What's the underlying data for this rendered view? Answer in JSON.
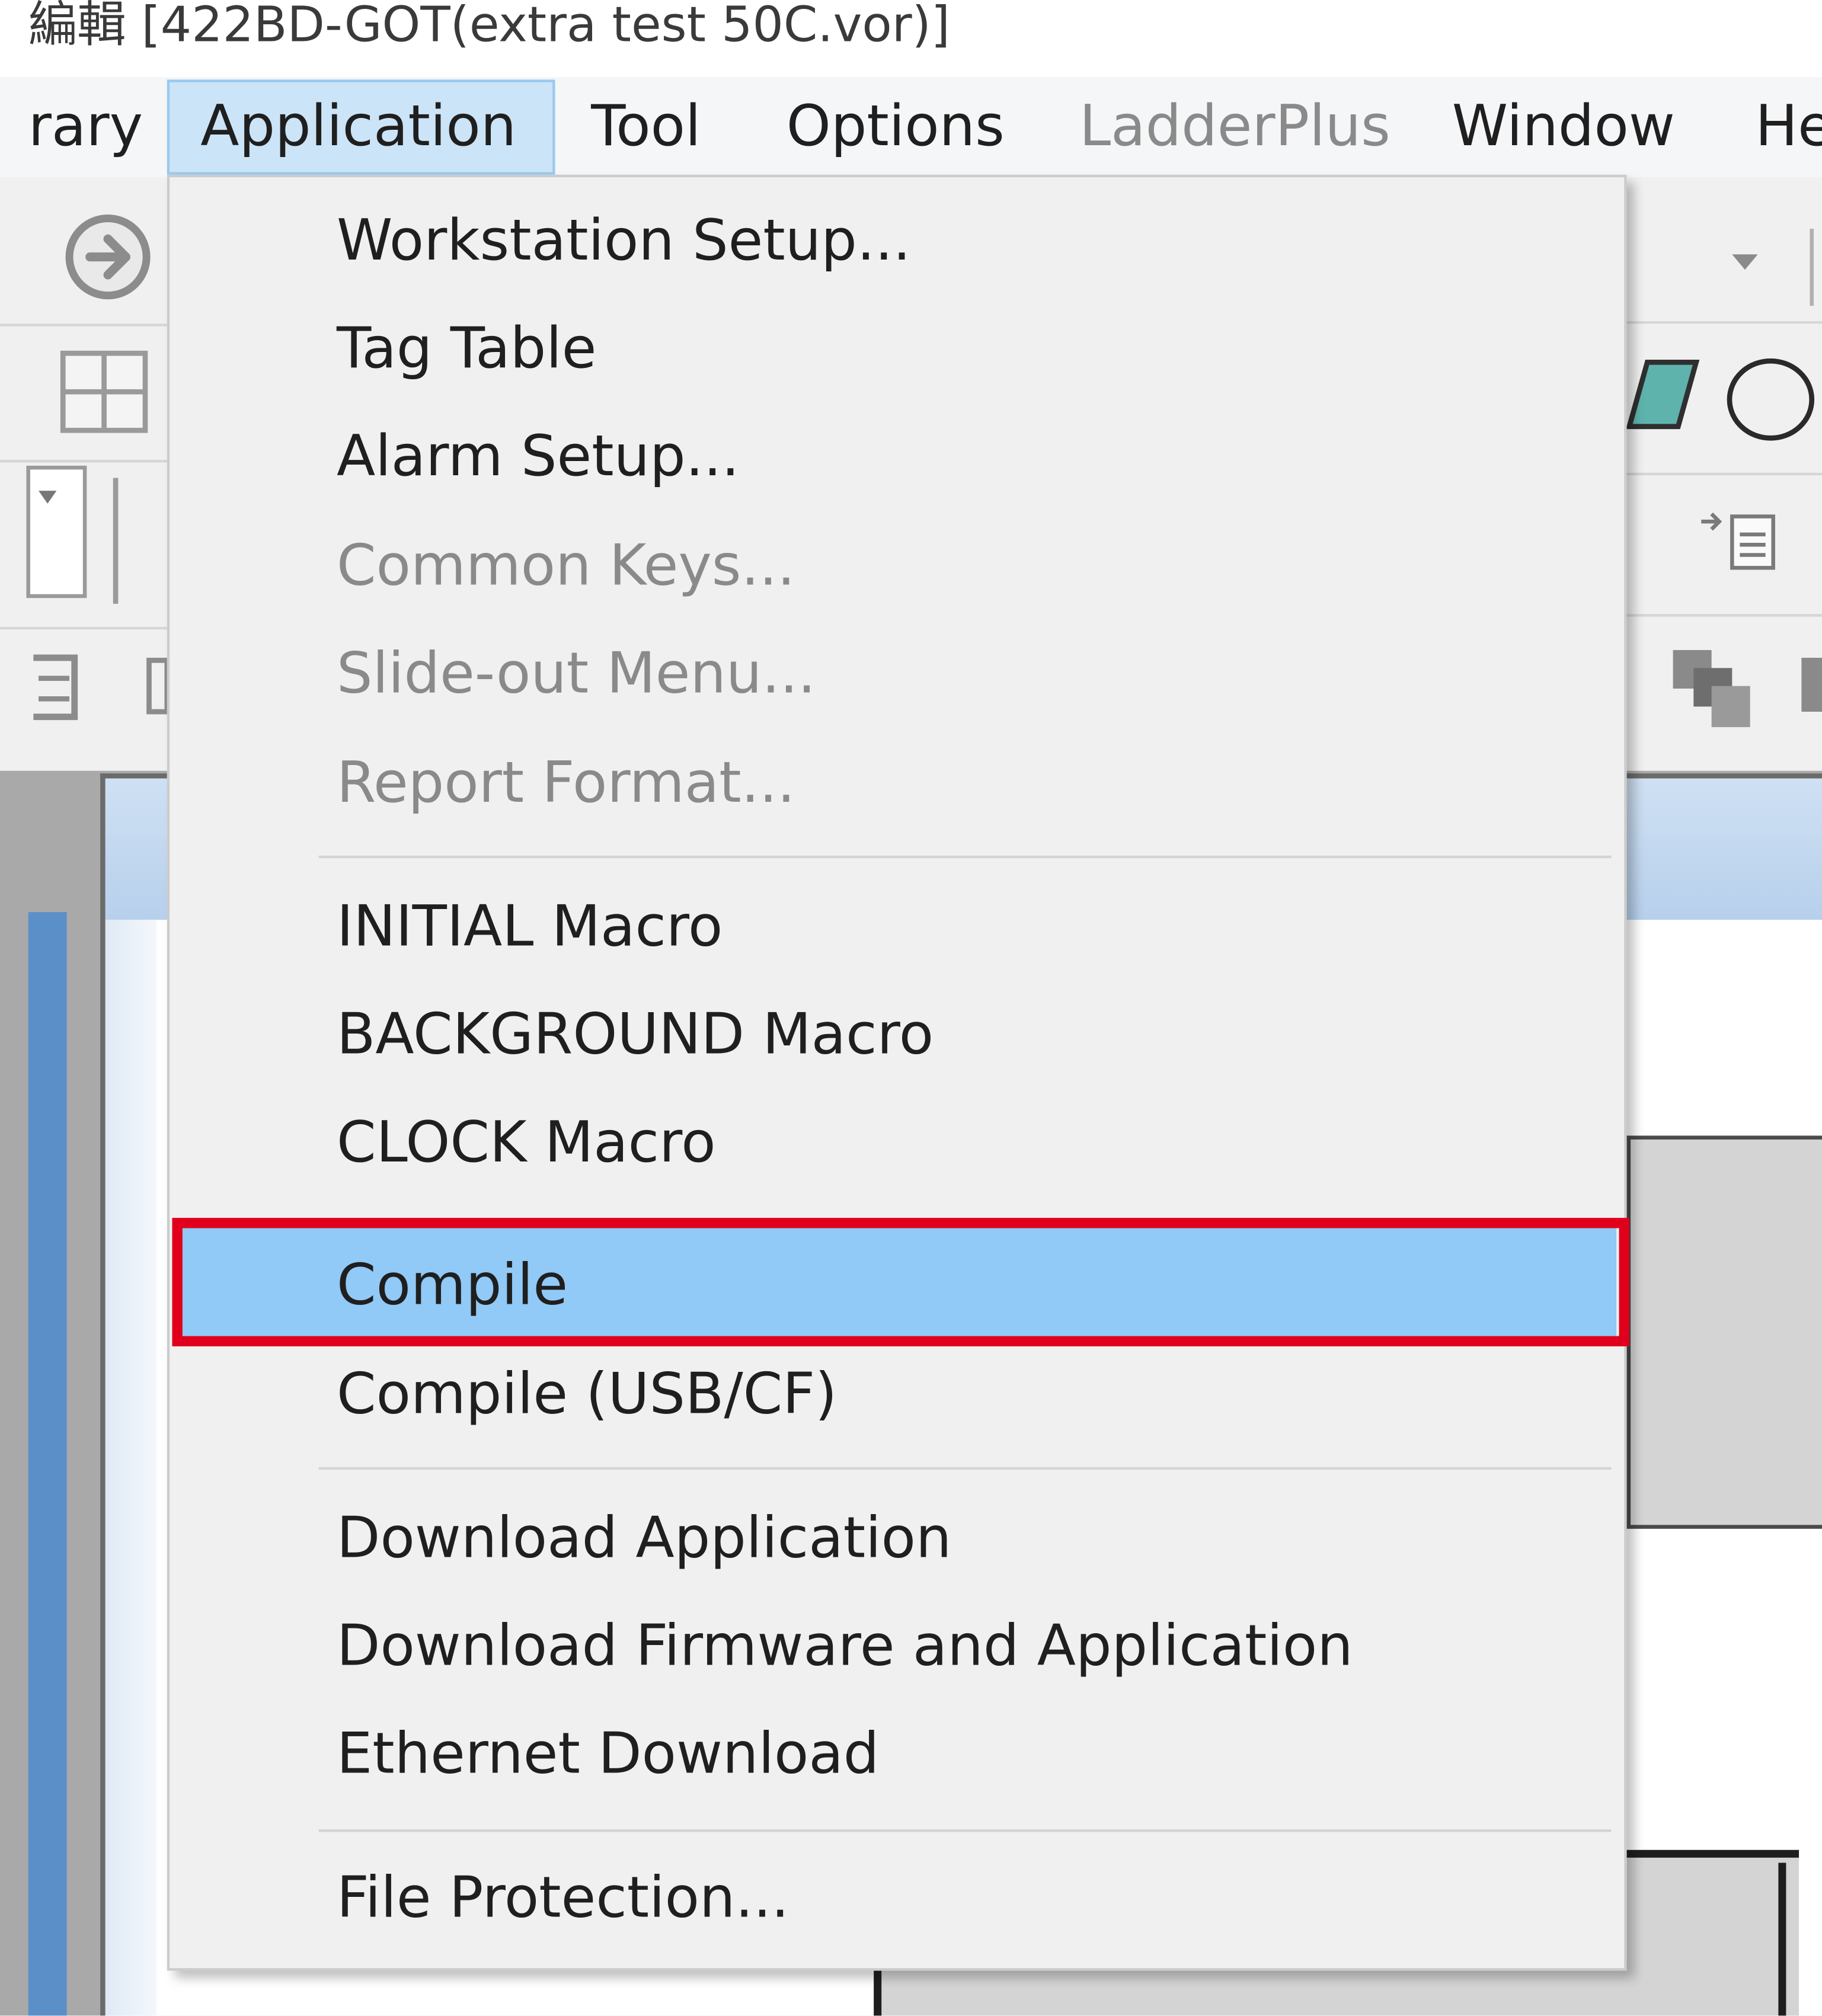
{
  "window": {
    "title": "編輯 [422BD-GOT(extra test 50C.vor)]"
  },
  "menubar": {
    "items": [
      {
        "label": "rary",
        "enabled": true
      },
      {
        "label": "Application",
        "enabled": true,
        "open": true
      },
      {
        "label": "Tool",
        "enabled": true
      },
      {
        "label": "Options",
        "enabled": true
      },
      {
        "label": "LadderPlus",
        "enabled": false
      },
      {
        "label": "Window",
        "enabled": true
      },
      {
        "label": "He",
        "enabled": true
      }
    ]
  },
  "application_menu": {
    "items": [
      {
        "label": "Workstation Setup...",
        "enabled": true
      },
      {
        "label": "Tag Table",
        "enabled": true
      },
      {
        "label": "Alarm Setup...",
        "enabled": true
      },
      {
        "label": "Common Keys...",
        "enabled": false
      },
      {
        "label": "Slide-out Menu...",
        "enabled": false
      },
      {
        "label": "Report Format...",
        "enabled": false
      },
      {
        "label": "INITIAL Macro",
        "enabled": true
      },
      {
        "label": "BACKGROUND Macro",
        "enabled": true
      },
      {
        "label": "CLOCK Macro",
        "enabled": true
      },
      {
        "label": "Compile",
        "enabled": true,
        "highlighted": true
      },
      {
        "label": "Compile (USB/CF)",
        "enabled": true
      },
      {
        "label": "Download Application",
        "enabled": true
      },
      {
        "label": "Download Firmware and Application",
        "enabled": true
      },
      {
        "label": "Ethernet Download",
        "enabled": true
      },
      {
        "label": "File Protection...",
        "enabled": true
      }
    ]
  },
  "icons": {
    "toolbar_left": [
      "forward-circle-icon",
      "grid-icon",
      "dropdown-icon",
      "align-icon"
    ],
    "toolbar_right": [
      "dropdown-arrow-icon",
      "parallelogram-icon",
      "circle-icon",
      "paste-icon",
      "layers-icon"
    ]
  },
  "colors": {
    "highlight": "#91c9f7",
    "annotation_border": "#e0001b",
    "menubar_open": "#cce4f7",
    "disabled_text": "#8a8a8a"
  }
}
